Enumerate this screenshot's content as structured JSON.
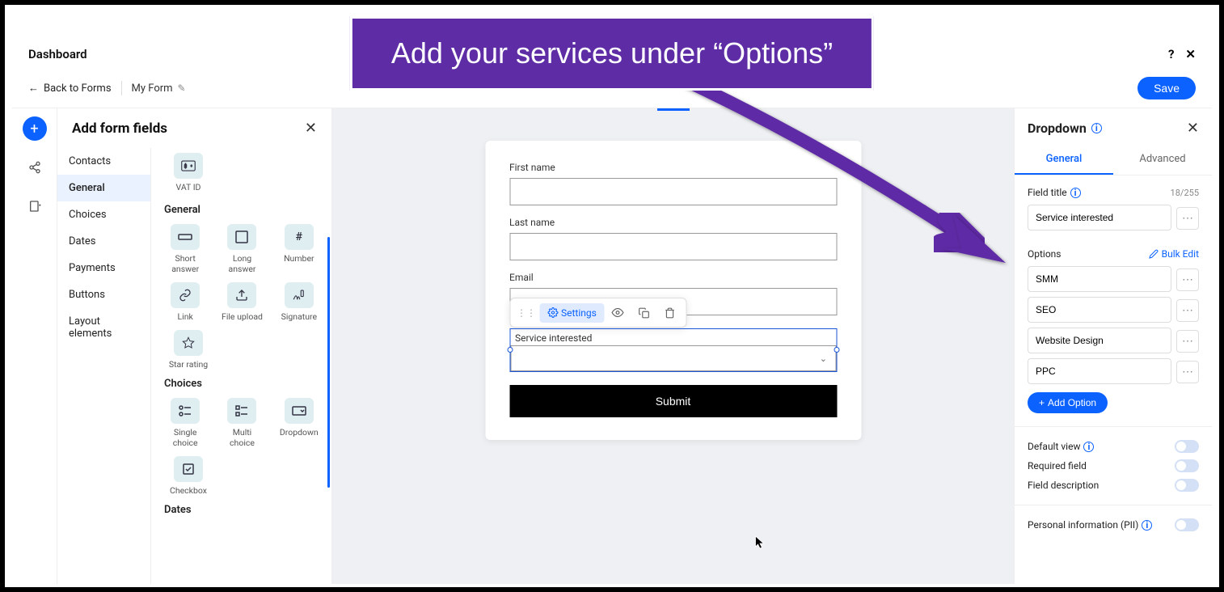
{
  "banner": "Add your services under “Options”",
  "dashboard_title": "Dashboard",
  "back_label": "Back to Forms",
  "form_name": "My Form",
  "save_label": "Save",
  "panel_title": "Add form fields",
  "categories": [
    "Contacts",
    "General",
    "Choices",
    "Dates",
    "Payments",
    "Buttons",
    "Layout elements"
  ],
  "vat_label": "VAT ID",
  "section_general": "General",
  "section_choices": "Choices",
  "section_dates": "Dates",
  "items_general": [
    "Short answer",
    "Long answer",
    "Number",
    "Link",
    "File upload",
    "Signature",
    "Star rating"
  ],
  "items_choices": [
    "Single choice",
    "Multi choice",
    "Dropdown",
    "Checkbox"
  ],
  "form": {
    "first_name": "First name",
    "last_name": "Last name",
    "email": "Email",
    "service": "Service interested",
    "submit": "Submit",
    "settings": "Settings"
  },
  "right": {
    "title": "Dropdown",
    "tab_general": "General",
    "tab_advanced": "Advanced",
    "field_title_label": "Field title",
    "field_title_count": "18/255",
    "field_title_value": "Service interested",
    "options_label": "Options",
    "bulk_edit": "Bulk Edit",
    "options": [
      "SMM",
      "SEO",
      "Website Design",
      "PPC"
    ],
    "add_option": "Add Option",
    "default_view": "Default view",
    "required_field": "Required field",
    "field_description": "Field description",
    "pii": "Personal information (PII)"
  }
}
